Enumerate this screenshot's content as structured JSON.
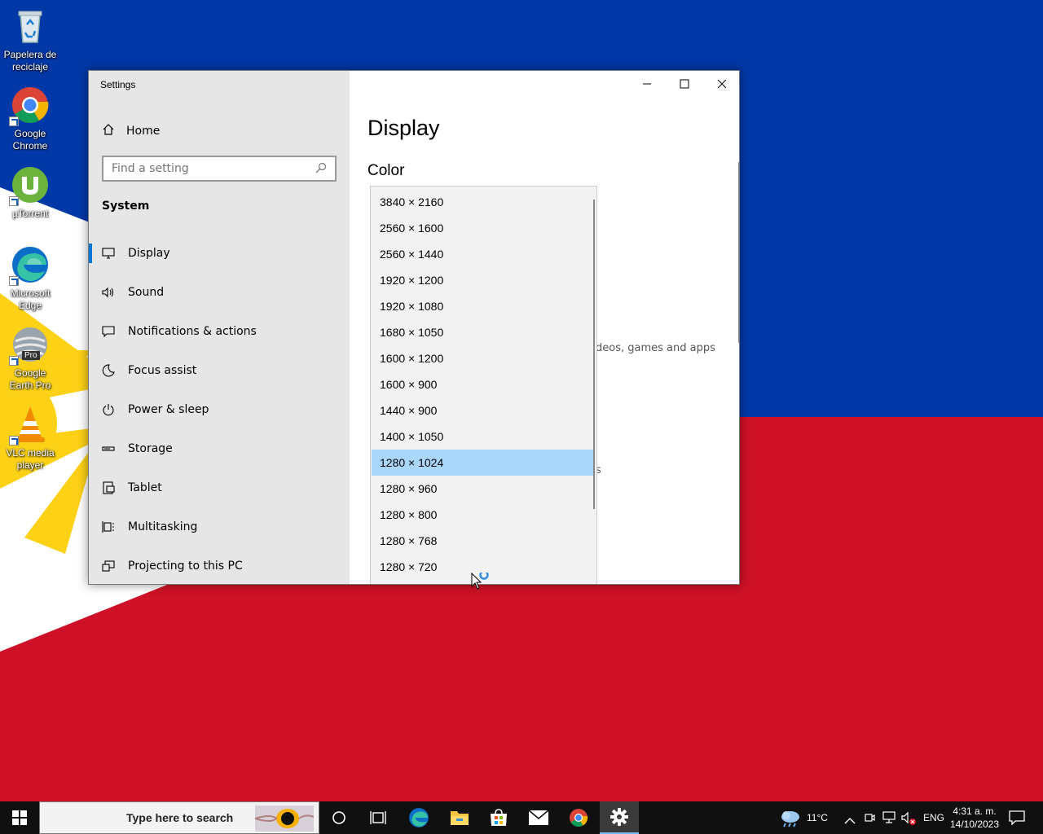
{
  "desktop": {
    "icons": [
      {
        "label": "Papelera de reciclaje"
      },
      {
        "label": "Google Chrome"
      },
      {
        "label": "µTorrent"
      },
      {
        "label": "Microsoft Edge"
      },
      {
        "label": "Google Earth Pro",
        "badge": "Pro"
      },
      {
        "label": "VLC media player"
      }
    ]
  },
  "window": {
    "title": "Settings",
    "nav": {
      "home": "Home",
      "search_placeholder": "Find a setting",
      "section": "System",
      "items": [
        {
          "label": "Display",
          "icon": "monitor-icon",
          "active": true
        },
        {
          "label": "Sound",
          "icon": "speaker-icon"
        },
        {
          "label": "Notifications & actions",
          "icon": "message-icon"
        },
        {
          "label": "Focus assist",
          "icon": "moon-icon"
        },
        {
          "label": "Power & sleep",
          "icon": "power-icon"
        },
        {
          "label": "Storage",
          "icon": "storage-icon"
        },
        {
          "label": "Tablet",
          "icon": "tablet-icon"
        },
        {
          "label": "Multitasking",
          "icon": "multitasking-icon"
        },
        {
          "label": "Projecting to this PC",
          "icon": "projector-icon"
        }
      ]
    },
    "content": {
      "page_title": "Display",
      "section_title": "Color",
      "partial_text": "deos, games and apps",
      "partial_s": "s"
    },
    "resolutions": [
      "3840 × 2160",
      "2560 × 1600",
      "2560 × 1440",
      "1920 × 1200",
      "1920 × 1080",
      "1680 × 1050",
      "1600 × 1200",
      "1600 × 900",
      "1440 × 900",
      "1400 × 1050",
      "1280 × 1024",
      "1280 × 960",
      "1280 × 800",
      "1280 × 768",
      "1280 × 720"
    ],
    "selected_resolution": "1280 × 1024"
  },
  "taskbar": {
    "search_placeholder": "Type here to search",
    "weather": "11°C",
    "language": "ENG",
    "time": "4:31 a. m.",
    "date": "14/10/2023"
  },
  "colors": {
    "accent": "#0078d7",
    "selected": "#abd6fb",
    "flag_blue": "#0038a8",
    "flag_red": "#ce1126",
    "sun": "#fcd116"
  }
}
